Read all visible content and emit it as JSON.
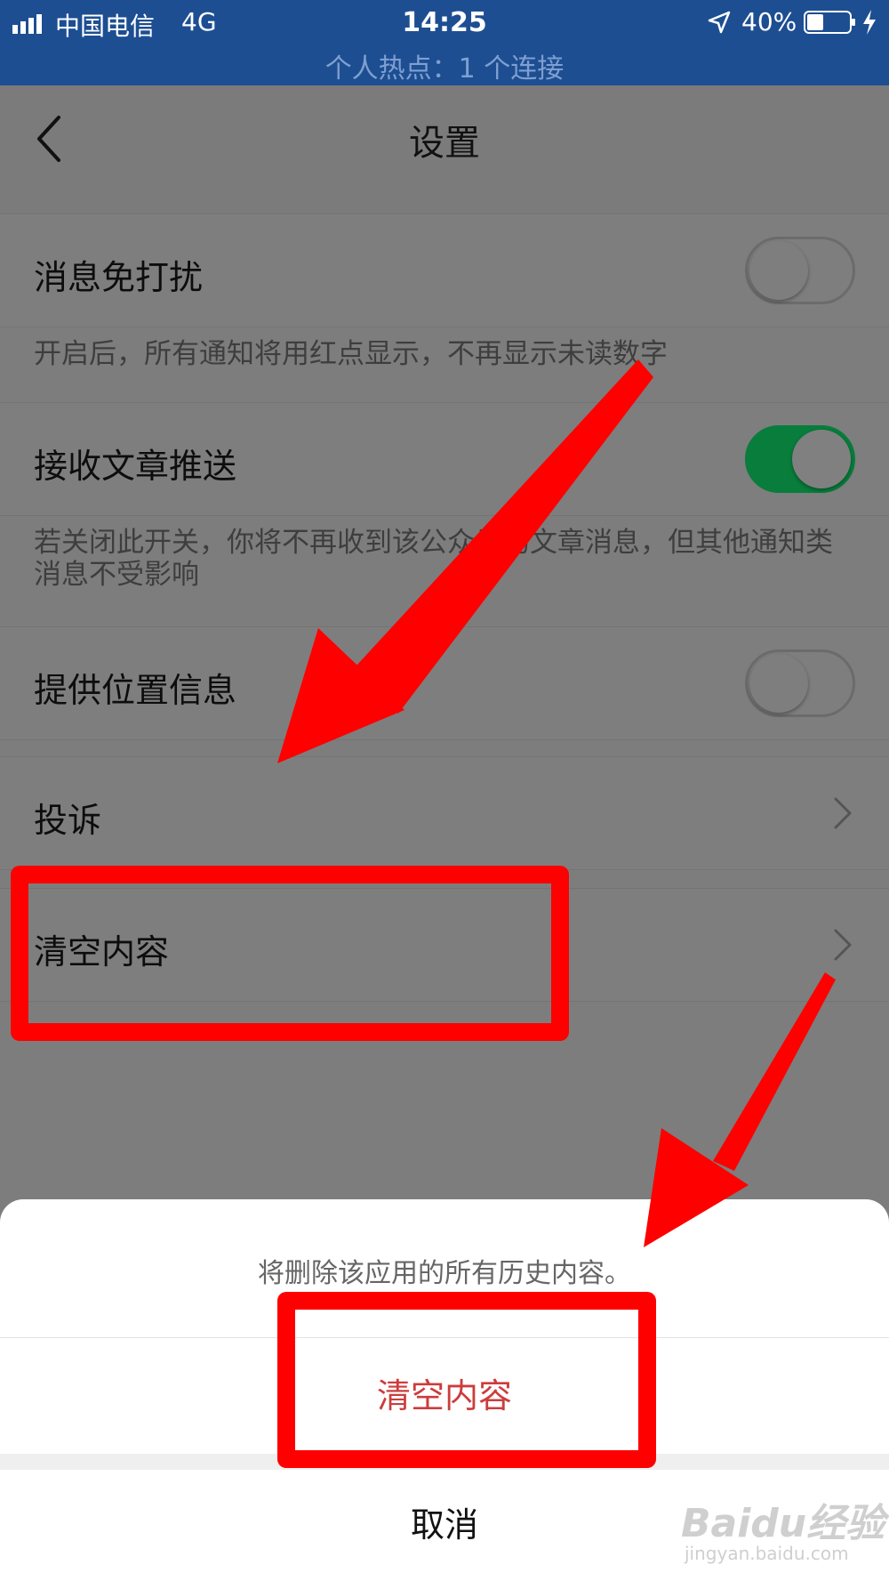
{
  "status_bar": {
    "carrier": "中国电信",
    "network": "4G",
    "time": "14:25",
    "hotspot": "个人热点：1 个连接",
    "battery": "40%"
  },
  "nav": {
    "title": "设置",
    "back_icon": "chevron-left-icon"
  },
  "settings": {
    "do_not_disturb": {
      "label": "消息免打扰",
      "enabled": false,
      "description": "开启后，所有通知将用红点显示，不再显示未读数字"
    },
    "article_push": {
      "label": "接收文章推送",
      "enabled": true,
      "description": "若关闭此开关，你将不再收到该公众号的文章消息，但其他通知类消息不受影响"
    },
    "location": {
      "label": "提供位置信息",
      "enabled": false
    },
    "complain": {
      "label": "投诉"
    },
    "clear_content": {
      "label": "清空内容"
    }
  },
  "action_sheet": {
    "message": "将删除该应用的所有历史内容。",
    "confirm_label": "清空内容",
    "cancel_label": "取消"
  },
  "colors": {
    "status_bar": "#1d4e92",
    "toggle_on": "#087d3c",
    "destructive": "#cc3d3d",
    "annotation": "#ff0000"
  },
  "watermark": {
    "logo": "Baidu经验",
    "url": "jingyan.baidu.com"
  }
}
